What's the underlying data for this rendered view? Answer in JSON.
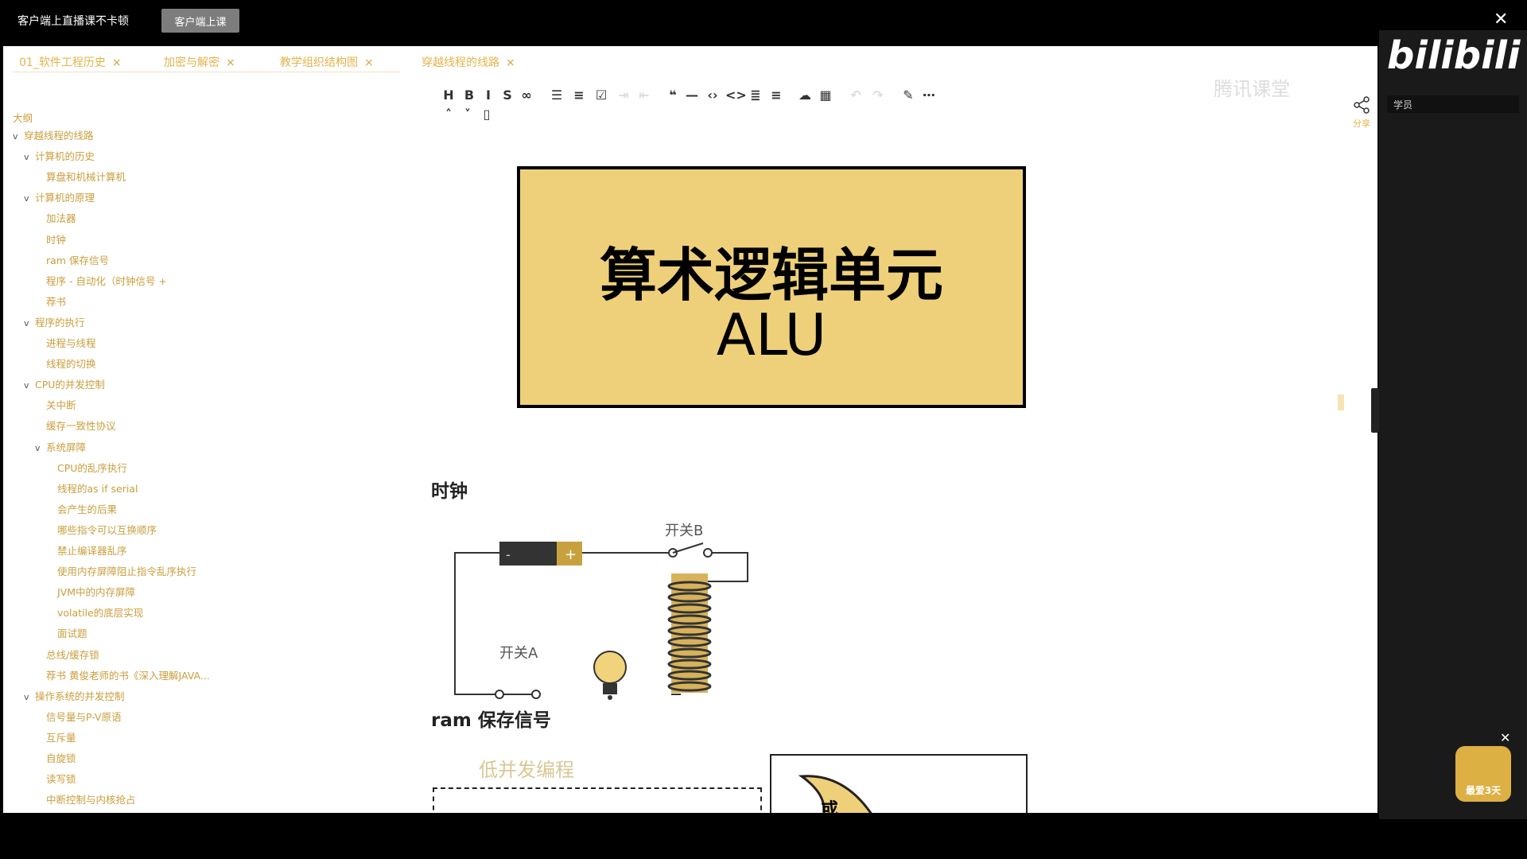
{
  "topbar": {
    "title": "客户端上直播课不卡顿",
    "button": "客户端上课",
    "close": "✕"
  },
  "tabs": [
    {
      "label": "01_软件工程历史",
      "close": "×"
    },
    {
      "label": "加密与解密",
      "close": "×"
    },
    {
      "label": "教学组织结构图",
      "close": "×"
    },
    {
      "label": "穿越线程的线路",
      "close": "×"
    }
  ],
  "outline": {
    "heading": "大纲",
    "items": [
      {
        "caret": "v",
        "label": "穿越线程的线路"
      },
      {
        "caret": "v",
        "label": "计算机的历史"
      },
      {
        "caret": "",
        "label": "算盘和机械计算机"
      },
      {
        "caret": "v",
        "label": "计算机的原理"
      },
      {
        "caret": "",
        "label": "加法器"
      },
      {
        "caret": "",
        "label": "时钟"
      },
      {
        "caret": "",
        "label": "ram 保存信号"
      },
      {
        "caret": "",
        "label": "程序 - 自动化（时钟信号 +"
      },
      {
        "caret": "",
        "label": "荐书"
      },
      {
        "caret": "v",
        "label": "程序的执行"
      },
      {
        "caret": "",
        "label": "进程与线程"
      },
      {
        "caret": "",
        "label": "线程的切换"
      },
      {
        "caret": "v",
        "label": "CPU的并发控制"
      },
      {
        "caret": "",
        "label": "关中断"
      },
      {
        "caret": "",
        "label": "缓存一致性协议"
      },
      {
        "caret": "v",
        "label": "系统屏障"
      },
      {
        "caret": "",
        "label": "CPU的乱序执行"
      },
      {
        "caret": "",
        "label": "线程的as if serial"
      },
      {
        "caret": "",
        "label": "会产生的后果"
      },
      {
        "caret": "",
        "label": "哪些指令可以互换顺序"
      },
      {
        "caret": "",
        "label": "禁止编译器乱序"
      },
      {
        "caret": "",
        "label": "使用内存屏障阻止指令乱序执行"
      },
      {
        "caret": "",
        "label": "JVM中的内存屏障"
      },
      {
        "caret": "",
        "label": "volatile的底层实现"
      },
      {
        "caret": "",
        "label": "面试题"
      },
      {
        "caret": "",
        "label": "总线/缓存锁"
      },
      {
        "caret": "",
        "label": "荐书 黄俊老师的书《深入理解JAVA..."
      },
      {
        "caret": "v",
        "label": "操作系统的并发控制"
      },
      {
        "caret": "",
        "label": "信号量与P-V原语"
      },
      {
        "caret": "",
        "label": "互斥量"
      },
      {
        "caret": "",
        "label": "自旋锁"
      },
      {
        "caret": "",
        "label": "读写锁"
      },
      {
        "caret": "",
        "label": "中断控制与内核抢占"
      }
    ]
  },
  "toolbar": {
    "icons": [
      "heading-icon",
      "bold-icon",
      "italic-icon",
      "strikethrough-icon",
      "link-icon",
      "bullet-list-icon",
      "ordered-list-icon",
      "checkbox-icon",
      "indent-icon",
      "outdent-icon",
      "quote-icon",
      "divider-icon",
      "code-icon",
      "inline-code-icon",
      "align-icon",
      "align-right-icon",
      "upload-icon",
      "table-icon",
      "undo-icon",
      "redo-icon",
      "pen-icon",
      "more-icon",
      "up-icon",
      "down-icon",
      "delete-icon"
    ],
    "glyphs": [
      "H",
      "B",
      "I",
      "S",
      "∞",
      "☰",
      "≡",
      "☑",
      "⇥",
      "⇤",
      "❝",
      "—",
      "‹›",
      "<>",
      "≣",
      "≡",
      "☁",
      "▦",
      "↶",
      "↷",
      "✎",
      "⋯",
      "˄",
      "˅",
      "▯"
    ]
  },
  "watermark": "腾讯课堂",
  "share": {
    "label": "分享"
  },
  "alu": {
    "title": "算术逻辑单元",
    "subtitle": "ALU"
  },
  "sections": {
    "clock": "时钟",
    "ram": "ram 保存信号"
  },
  "circuit": {
    "switch_b": "开关B",
    "switch_a": "开关A",
    "minus": "-",
    "plus": "+"
  },
  "bottom": {
    "left_label": "低并发编程",
    "gate_label": "或"
  },
  "panel": {
    "logo": "bilibili",
    "tab": "学员",
    "close": "✕",
    "badge": "最爱3天"
  },
  "colors": {
    "accent": "#e3b34a",
    "alu_fill": "#efd07a",
    "panel_bg": "#1a1a1a"
  }
}
